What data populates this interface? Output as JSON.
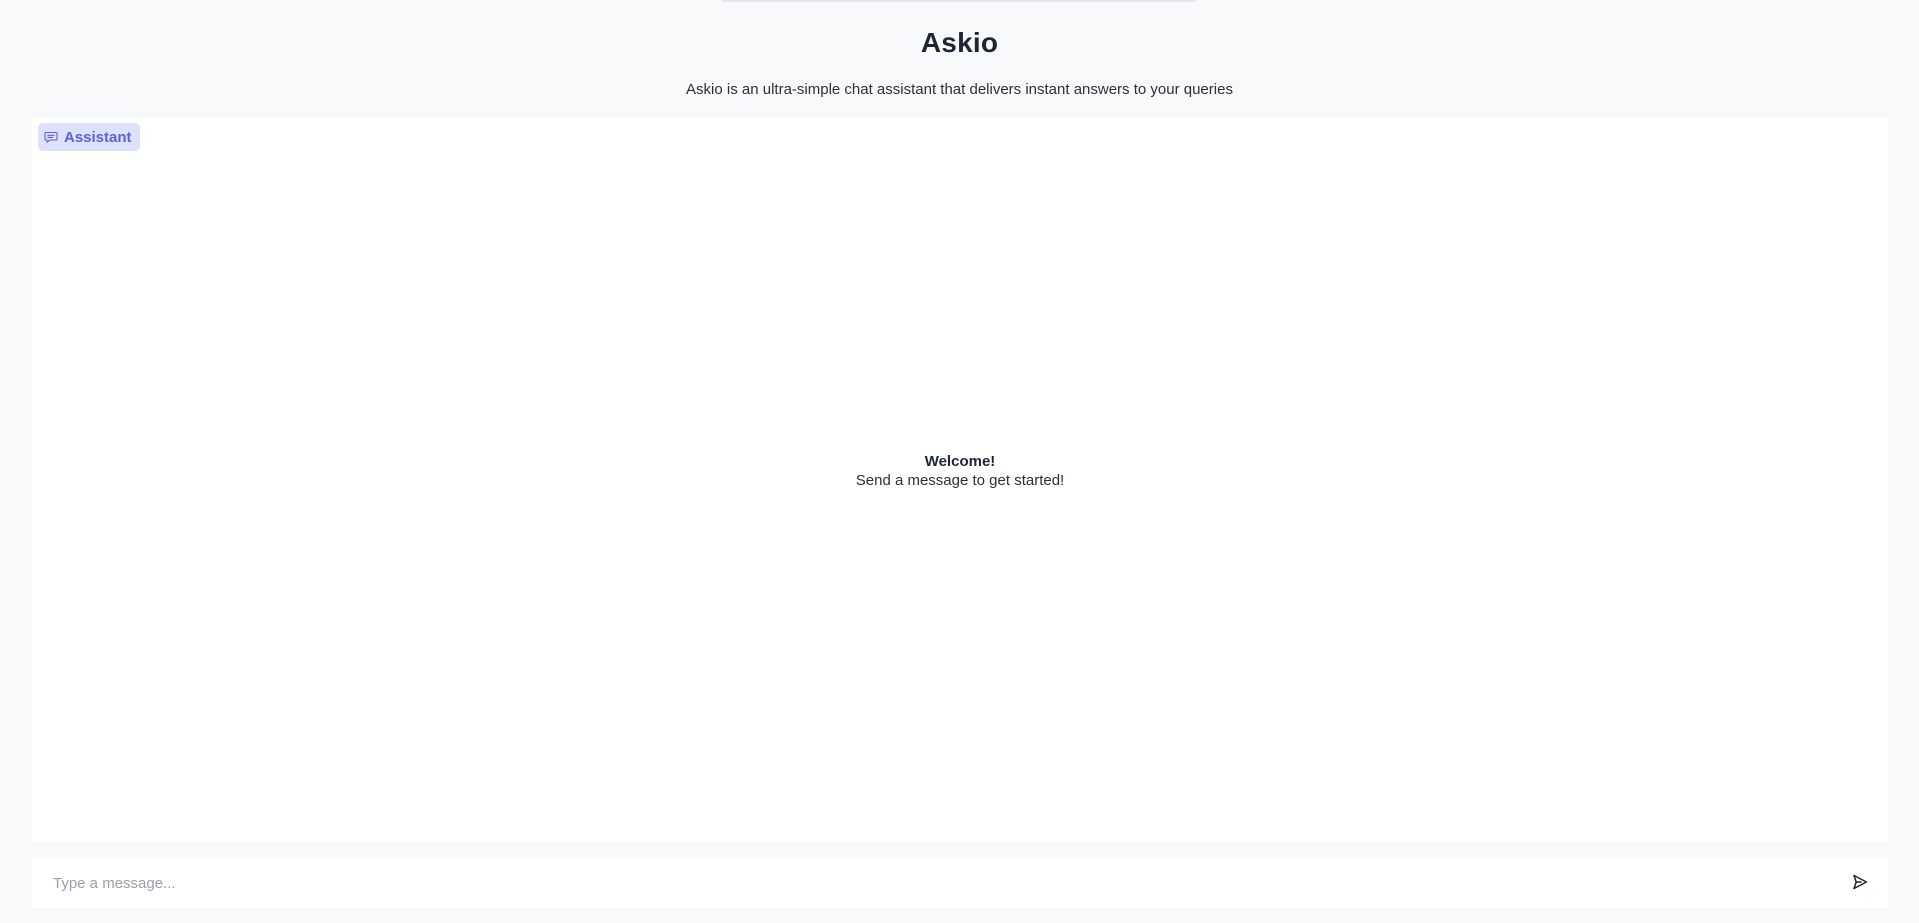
{
  "header": {
    "title": "Askio",
    "subtitle": "Askio is an ultra-simple chat assistant that delivers instant answers to your queries"
  },
  "chat": {
    "assistant_badge": {
      "label": "Assistant",
      "icon": "chat-bubble-icon"
    },
    "welcome": {
      "title": "Welcome!",
      "text": "Send a message to get started!"
    }
  },
  "composer": {
    "placeholder": "Type a message...",
    "value": "",
    "send_icon": "send-icon"
  },
  "colors": {
    "background": "#f8f9fb",
    "panel": "#ffffff",
    "accent": "#5b63d8",
    "badge_background": "#dde1fb",
    "text": "#1f2633",
    "placeholder": "#9aa0ab"
  }
}
